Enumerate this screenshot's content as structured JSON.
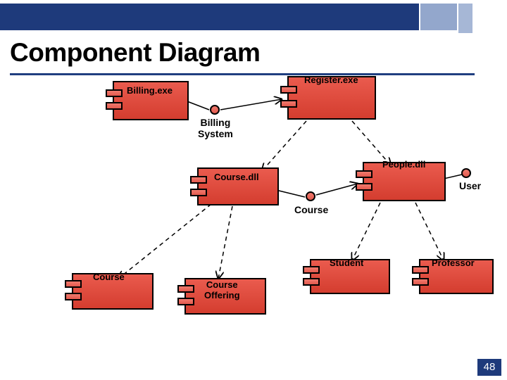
{
  "slide": {
    "title": "Component Diagram",
    "page_number": "48"
  },
  "components": {
    "billing_exe": "Billing.exe",
    "register_exe": "Register.exe",
    "course_dll": "Course.dll",
    "people_dll": "People.dll",
    "course_left": "Course",
    "course_offering_line1": "Course",
    "course_offering_line2": "Offering",
    "student": "Student",
    "professor": "Professor"
  },
  "interfaces": {
    "billing_system_line1": "Billing",
    "billing_system_line2": "System",
    "course": "Course",
    "user": "User"
  }
}
